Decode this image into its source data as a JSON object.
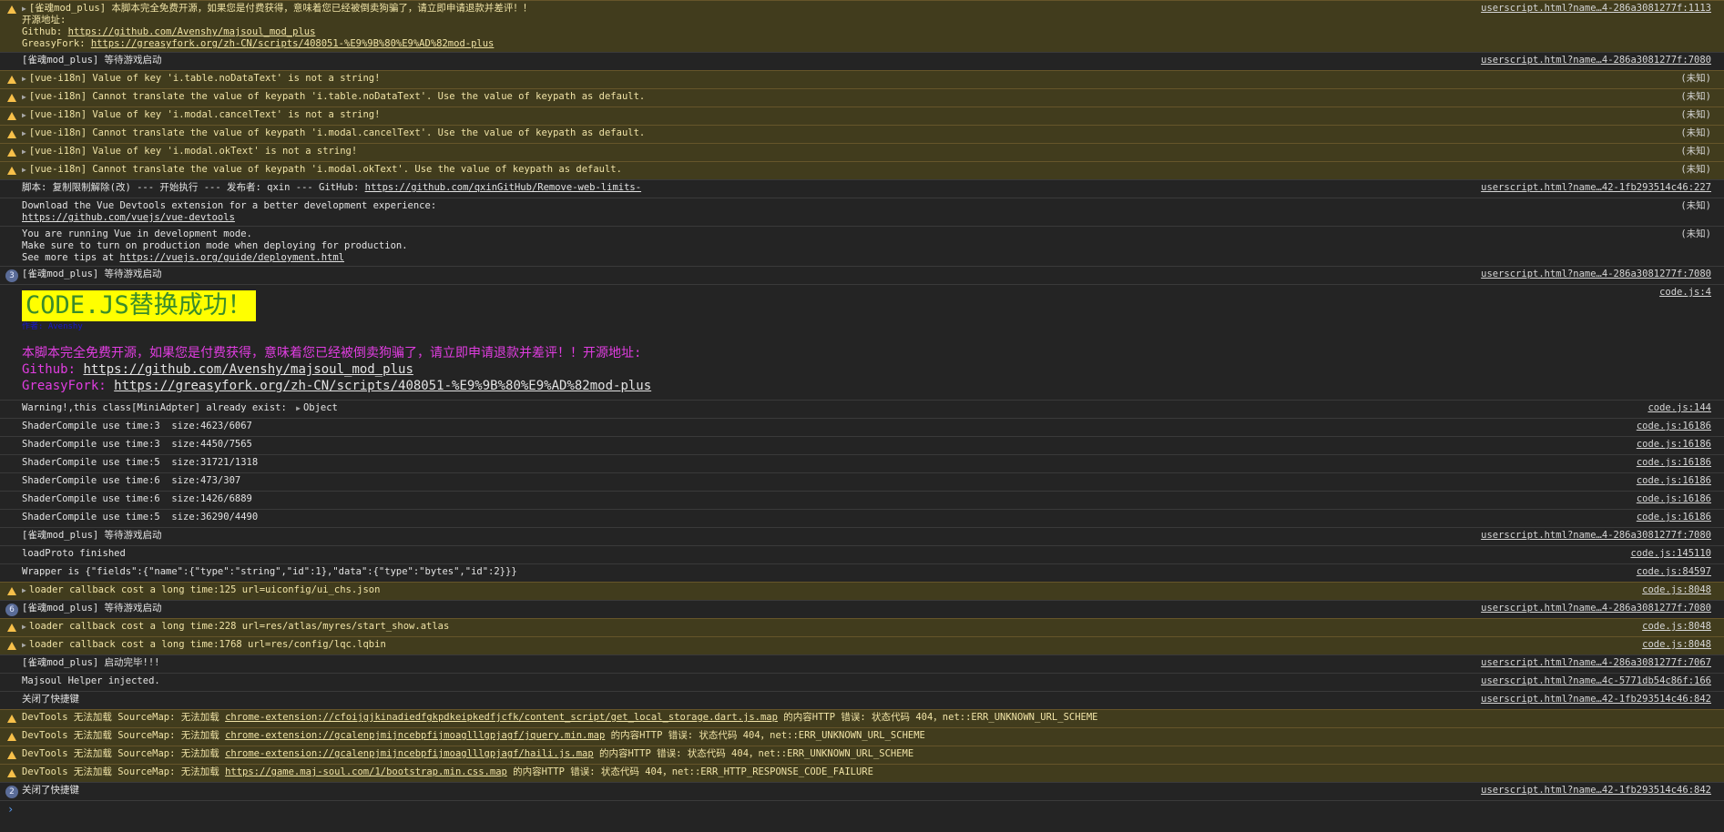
{
  "colors": {
    "background": "#242424",
    "warning_bg": "#413c1d",
    "warning_icon": "#f7c04a",
    "badge": "#5a6c98",
    "code_highlight": "#ffff00",
    "code_text": "#3a8c2a",
    "magenta": "#e03de0"
  },
  "rows": [
    {
      "src": "userscript.html?name…4-286a3081277f:1113",
      "l1": "[雀魂mod_plus] 本脚本完全免费开源，如果您是付费获得，意味着您已经被倒卖狗骗了，请立即申请退款并差评！！",
      "l2": "开源地址:",
      "gh_label": "Github: ",
      "gh_url": "https://github.com/Avenshy/majsoul_mod_plus",
      "gf_label": "GreasyFork: ",
      "gf_url": "https://greasyfork.org/zh-CN/scripts/408051-%E9%9B%80%E9%AD%82mod-plus"
    },
    {
      "msg": "[雀魂mod_plus] 等待游戏启动",
      "src": "userscript.html?name…4-286a3081277f:7080"
    },
    {
      "msg": "[vue-i18n] Value of key 'i.table.noDataText' is not a string!",
      "src": "(未知)"
    },
    {
      "msg": "[vue-i18n] Cannot translate the value of keypath 'i.table.noDataText'. Use the value of keypath as default.",
      "src": "(未知)"
    },
    {
      "msg": "[vue-i18n] Value of key 'i.modal.cancelText' is not a string!",
      "src": "(未知)"
    },
    {
      "msg": "[vue-i18n] Cannot translate the value of keypath 'i.modal.cancelText'. Use the value of keypath as default.",
      "src": "(未知)"
    },
    {
      "msg": "[vue-i18n] Value of key 'i.modal.okText' is not a string!",
      "src": "(未知)"
    },
    {
      "msg": "[vue-i18n] Cannot translate the value of keypath 'i.modal.okText'. Use the value of keypath as default.",
      "src": "(未知)"
    },
    {
      "msg": "脚本: 复制限制解除(改) --- 开始执行 --- 发布者: qxin --- GitHub: ",
      "link": "https://github.com/qxinGitHub/Remove-web-limits-",
      "src": "userscript.html?name…42-1fb293514c46:227"
    },
    {
      "l1": "Download the Vue Devtools extension for a better development experience:",
      "link": "https://github.com/vuejs/vue-devtools",
      "src": "(未知)"
    },
    {
      "l1": "You are running Vue in development mode.",
      "l2": "Make sure to turn on production mode when deploying for production.",
      "l3": "See more tips at ",
      "link": "https://vuejs.org/guide/deployment.html",
      "src": "(未知)"
    },
    {
      "badge": "3",
      "msg": "[雀魂mod_plus] 等待游戏启动",
      "src": "userscript.html?name…4-286a3081277f:7080"
    },
    {
      "big": "CODE.JS替换成功！",
      "author": "作者: Avenshy",
      "m1": "本脚本完全免费开源，如果您是付费获得，意味着您已经被倒卖狗骗了，请立即申请退款并差评！！开源地址:",
      "gh_label": "Github: ",
      "gh_url": "https://github.com/Avenshy/majsoul_mod_plus",
      "gf_label": "GreasyFork: ",
      "gf_url": "https://greasyfork.org/zh-CN/scripts/408051-%E9%9B%80%E9%AD%82mod-plus",
      "src": "code.js:4"
    },
    {
      "msg": "Warning!,this class[MiniAdpter] already exist: ",
      "obj": "Object",
      "src": "code.js:144"
    },
    {
      "msg": "ShaderCompile use time:3  size:4623/6067",
      "src": "code.js:16186"
    },
    {
      "msg": "ShaderCompile use time:3  size:4450/7565",
      "src": "code.js:16186"
    },
    {
      "msg": "ShaderCompile use time:5  size:31721/1318",
      "src": "code.js:16186"
    },
    {
      "msg": "ShaderCompile use time:6  size:473/307",
      "src": "code.js:16186"
    },
    {
      "msg": "ShaderCompile use time:6  size:1426/6889",
      "src": "code.js:16186"
    },
    {
      "msg": "ShaderCompile use time:5  size:36290/4490",
      "src": "code.js:16186"
    },
    {
      "msg": "[雀魂mod_plus] 等待游戏启动",
      "src": "userscript.html?name…4-286a3081277f:7080"
    },
    {
      "msg": "loadProto finished",
      "src": "code.js:145110"
    },
    {
      "msg": "Wrapper is {\"fields\":{\"name\":{\"type\":\"string\",\"id\":1},\"data\":{\"type\":\"bytes\",\"id\":2}}}",
      "src": "code.js:84597"
    },
    {
      "msg": "loader callback cost a long time:125 url=uiconfig/ui_chs.json",
      "src": "code.js:8048"
    },
    {
      "badge": "6",
      "msg": "[雀魂mod_plus] 等待游戏启动",
      "src": "userscript.html?name…4-286a3081277f:7080"
    },
    {
      "msg": "loader callback cost a long time:228 url=res/atlas/myres/start_show.atlas",
      "src": "code.js:8048"
    },
    {
      "msg": "loader callback cost a long time:1768 url=res/config/lqc.lqbin",
      "src": "code.js:8048"
    },
    {
      "msg": "[雀魂mod_plus] 启动完毕!!!",
      "src": "userscript.html?name…4-286a3081277f:7067"
    },
    {
      "msg": "Majsoul Helper injected.",
      "src": "userscript.html?name…4c-5771db54c86f:166"
    },
    {
      "msg": "关闭了快捷键",
      "src": "userscript.html?name…42-1fb293514c46:842"
    },
    {
      "pre": "DevTools 无法加载 SourceMap: 无法加载 ",
      "link": "chrome-extension://cfoijgjkinadiedfgkpdkeipkedfjcfk/content_script/get_local_storage.dart.js.map",
      "post": " 的内容HTTP 错误: 状态代码 404，net::ERR_UNKNOWN_URL_SCHEME"
    },
    {
      "pre": "DevTools 无法加载 SourceMap: 无法加载 ",
      "link": "chrome-extension://gcalenpjmijncebpfijmoaglllgpjagf/jquery.min.map",
      "post": " 的内容HTTP 错误: 状态代码 404，net::ERR_UNKNOWN_URL_SCHEME"
    },
    {
      "pre": "DevTools 无法加载 SourceMap: 无法加载 ",
      "link": "chrome-extension://gcalenpjmijncebpfijmoaglllgpjagf/haili.js.map",
      "post": " 的内容HTTP 错误: 状态代码 404，net::ERR_UNKNOWN_URL_SCHEME"
    },
    {
      "pre": "DevTools 无法加载 SourceMap: 无法加载 ",
      "link": "https://game.maj-soul.com/1/bootstrap.min.css.map",
      "post": " 的内容HTTP 错误: 状态代码 404，net::ERR_HTTP_RESPONSE_CODE_FAILURE"
    },
    {
      "badge": "2",
      "msg": "关闭了快捷键",
      "src": "userscript.html?name…42-1fb293514c46:842"
    }
  ],
  "prompt": {
    "symbol": "›"
  }
}
